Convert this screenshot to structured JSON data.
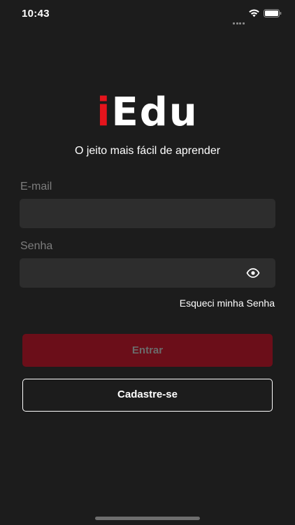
{
  "status_bar": {
    "time": "10:43",
    "icons": [
      "signal-icon",
      "wifi-icon",
      "battery-icon"
    ]
  },
  "logo": {
    "first_letter": "i",
    "rest": "Edu",
    "accent_color": "#e5141c"
  },
  "tagline": "O jeito mais fácil de aprender",
  "email": {
    "label": "E-mail",
    "value": "",
    "placeholder": ""
  },
  "password": {
    "label": "Senha",
    "value": "",
    "placeholder": "",
    "toggle_icon": "eye-icon"
  },
  "forgot_password": "Esqueci minha Senha",
  "buttons": {
    "login": "Entrar",
    "signup": "Cadastre-se"
  },
  "colors": {
    "background": "#1c1c1c",
    "field_background": "#2d2d2d",
    "login_button": "#6b0e19",
    "brand_red": "#e5141c"
  }
}
